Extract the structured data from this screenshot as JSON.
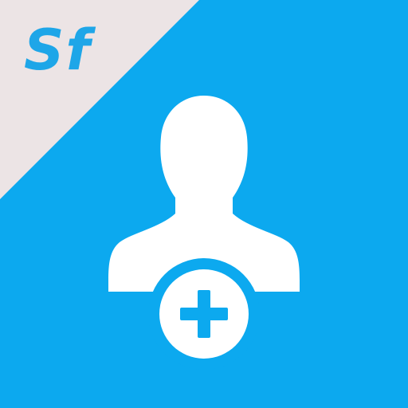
{
  "app_icon": {
    "logo_text": "Sf",
    "icon_name": "add-user-icon",
    "colors": {
      "background": "#0ca9ef",
      "corner_banner": "#ece4e5",
      "logo": "#1ea6e8",
      "glyph": "#ffffff"
    }
  }
}
